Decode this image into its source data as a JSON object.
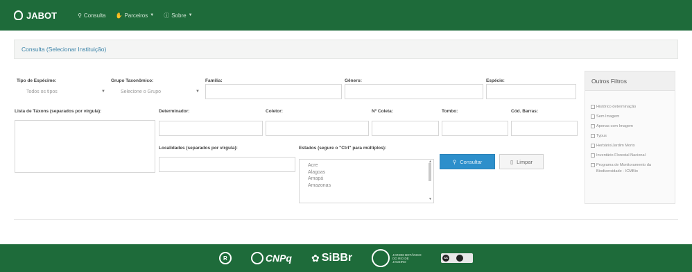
{
  "navbar": {
    "brand": "JABOT",
    "items": [
      {
        "label": "Consulta",
        "icon": "search-icon",
        "caret": false
      },
      {
        "label": "Parceiros",
        "icon": "thumbs-up-icon",
        "caret": true
      },
      {
        "label": "Sobre",
        "icon": "info-icon",
        "caret": true
      }
    ]
  },
  "page_title": "Consulta (Selecionar Instituição)",
  "form": {
    "tipo_espécime": {
      "label": "Tipo de Espécime:",
      "value": "Todos os tipos"
    },
    "grupo_taxonomico": {
      "label": "Grupo Taxonômico:",
      "value": "Selecione o Grupo"
    },
    "familia": {
      "label": "Família:"
    },
    "genero": {
      "label": "Gênero:"
    },
    "especie": {
      "label": "Espécie:"
    },
    "lista_taxons": {
      "label": "Lista de Táxons (separados por vírgula):"
    },
    "determinador": {
      "label": "Determinador:"
    },
    "coletor": {
      "label": "Coletor:"
    },
    "numero_coleta": {
      "label": "Nº Coleta:"
    },
    "tombo": {
      "label": "Tombo:"
    },
    "cod_barras": {
      "label": "Cód. Barras:"
    },
    "localidades": {
      "label": "Localidades (separados por vírgula):"
    },
    "estados": {
      "label": "Estados (segure o \"Ctrl\" para múltiplos):",
      "options": [
        "Acre",
        "Alagoas",
        "Amapá",
        "Amazonas"
      ]
    },
    "consultar_label": "Consultar",
    "limpar_label": "Limpar"
  },
  "filters": {
    "title": "Outros Filtros",
    "items": [
      "Histórico determinação",
      "Sem Imagem",
      "Apenas com Imagem",
      "Typus",
      "Herbário/Jardim Morto",
      "Inventário Florestal Nacional",
      "Programa de Monitoramento da Biodiversidade - ICMBio"
    ]
  },
  "footer": {
    "logo1_letter": "R",
    "cnpq": "CNPq",
    "sibbr": "SiBBr",
    "jbrj": "JARDIM BOTÂNICO DO RIO DE JANEIRO",
    "cc": "cc"
  },
  "colors": {
    "primary_green": "#1e6b3a",
    "button_blue": "#2d8fcb",
    "link_blue": "#3a83a8"
  }
}
